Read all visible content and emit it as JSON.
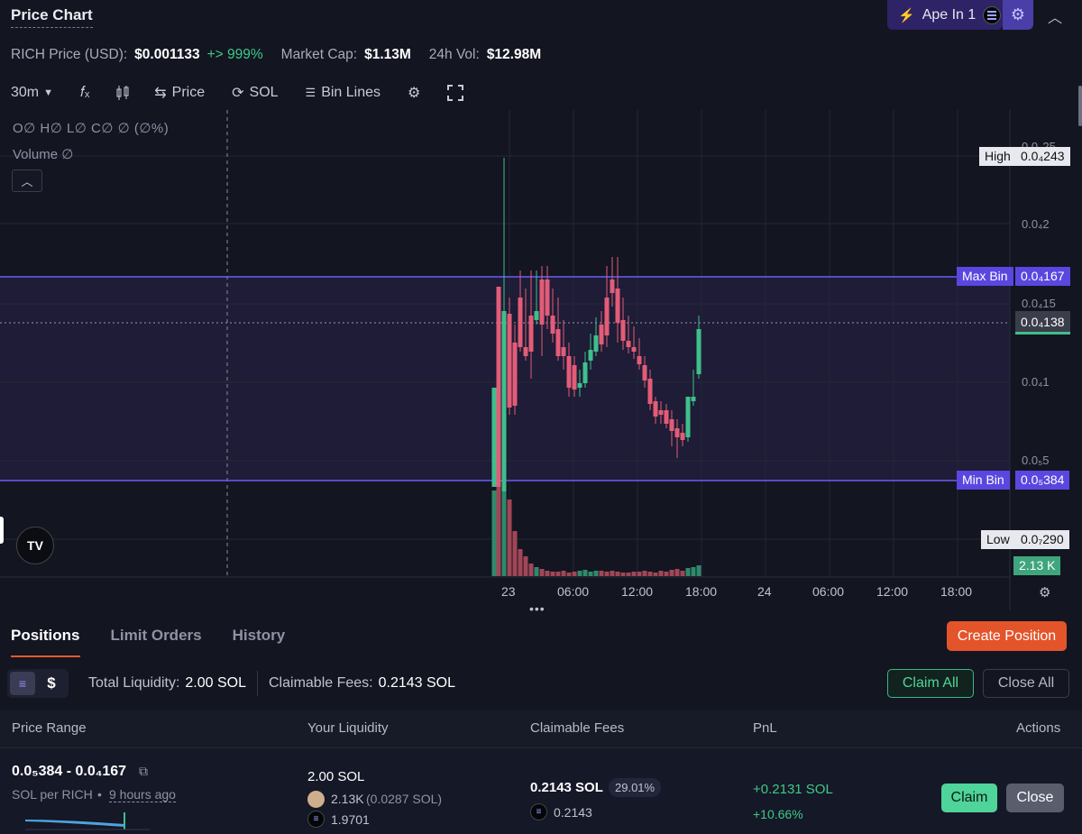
{
  "header": {
    "title": "Price Chart",
    "ape_label": "Ape In 1",
    "settings_icon": "gear-icon",
    "collapse_icon": "chevron-up-icon"
  },
  "price_bar": {
    "price_label": "RICH Price (USD):",
    "price": "$0.001133",
    "change": "+> 999%",
    "mcap_label": "Market Cap:",
    "mcap": "$1.13M",
    "vol_label": "24h Vol:",
    "vol": "$12.98M"
  },
  "toolbar": {
    "interval": "30m",
    "indicator_symbol": "𝑓ₓ",
    "price_toggle": "Price",
    "sol_toggle": "SOL",
    "bin_lines": "Bin Lines"
  },
  "legend": {
    "ohlc": "O∅ H∅ L∅ C∅ ∅ (∅%)",
    "volume": "Volume ∅"
  },
  "chart_labels": {
    "high_label": "High",
    "high_value": "0.0₄243",
    "maxbin_label": "Max Bin",
    "maxbin_value": "0.0₄167",
    "current_value": "0.0₄138",
    "minbin_label": "Min Bin",
    "minbin_value": "0.0₅384",
    "low_label": "Low",
    "low_value": "0.0₇290",
    "volume_value": "2.13 K",
    "y_ticks": [
      "0.0₄25",
      "0.0₄2",
      "0.0₄15",
      "0.0₄1",
      "0.0₅5"
    ],
    "x_ticks": [
      "23",
      "06:00",
      "12:00",
      "18:00",
      "24",
      "06:00",
      "12:00",
      "18:00"
    ]
  },
  "chart_data": {
    "type": "candlestick",
    "series_note": "",
    "x_ticks": [
      "23",
      "06:00",
      "12:00",
      "18:00",
      "24",
      "06:00",
      "12:00",
      "18:00"
    ],
    "high": "0.0₄243",
    "low": "0.0₇290",
    "max_bin": "0.0₄167",
    "min_bin": "0.0₅384",
    "last": "0.0₄138",
    "volume_last": "2.13 K"
  },
  "colors": {
    "up": "#3fbf8c",
    "down": "#e35c78",
    "bin_line": "#6b5cf5",
    "accent": "#e4542a"
  },
  "tabs": {
    "positions": "Positions",
    "limit_orders": "Limit Orders",
    "history": "History"
  },
  "create_position": "Create Position",
  "summary": {
    "total_label": "Total Liquidity:",
    "total": "2.00 SOL",
    "fees_label": "Claimable Fees:",
    "fees": "0.2143 SOL",
    "claim_all": "Claim All",
    "close_all": "Close All",
    "dollar": "$"
  },
  "table": {
    "headers": [
      "Price Range",
      "Your Liquidity",
      "Claimable Fees",
      "PnL",
      "Actions"
    ]
  },
  "row": {
    "range": "0.0₅384 - 0.0₄167",
    "unit": "SOL per RICH",
    "age": "9 hours ago",
    "liquidity": "2.00 SOL",
    "token_amt": "2.13K",
    "token_sol": "(0.0287 SOL)",
    "sol_amt": "1.9701",
    "fees": "0.2143 SOL",
    "fees_pct": "29.01%",
    "fees_sol": "0.2143",
    "pnl": "+0.2131 SOL",
    "pnl_pct": "+10.66%",
    "claim": "Claim",
    "close": "Close"
  }
}
